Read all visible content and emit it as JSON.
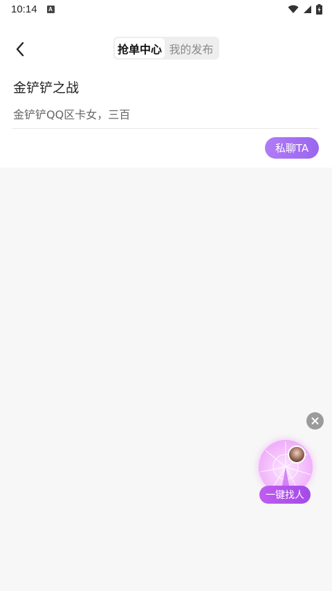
{
  "status_bar": {
    "time": "10:14",
    "notification_badge": "A"
  },
  "header": {
    "tabs": [
      {
        "label": "抢单中心",
        "active": true
      },
      {
        "label": "我的发布",
        "active": false
      }
    ]
  },
  "post": {
    "title": "金铲铲之战",
    "description": "金铲铲QQ区卡女，三百",
    "chat_button": "私聊TA"
  },
  "floating": {
    "find_label": "一键找人"
  },
  "colors": {
    "accent": "#9a66ef",
    "find_gradient_start": "#c15cf0",
    "find_gradient_end": "#a24be8"
  }
}
